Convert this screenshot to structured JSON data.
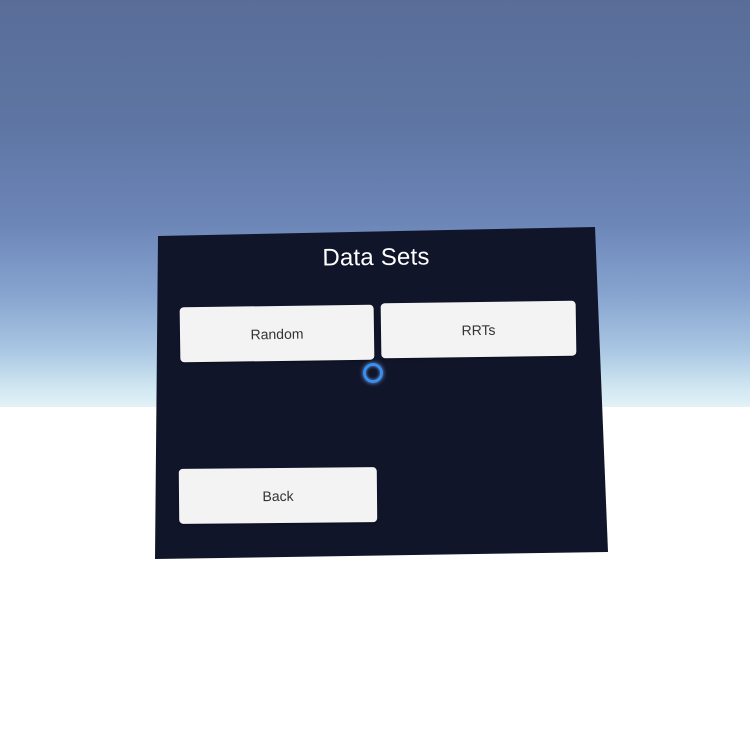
{
  "panel": {
    "title": "Data Sets"
  },
  "buttons": {
    "random": "Random",
    "rrts": "RRTs",
    "back": "Back"
  },
  "colors": {
    "panel_bg": "#11152a",
    "button_bg": "#f3f3f4",
    "button_text": "#333333",
    "title_text": "#ffffff",
    "reticle": "#3a8ef0",
    "sky_top": "#596d98",
    "ground": "#ffffff"
  },
  "icons": {
    "reticle": "gaze-reticle-icon"
  }
}
